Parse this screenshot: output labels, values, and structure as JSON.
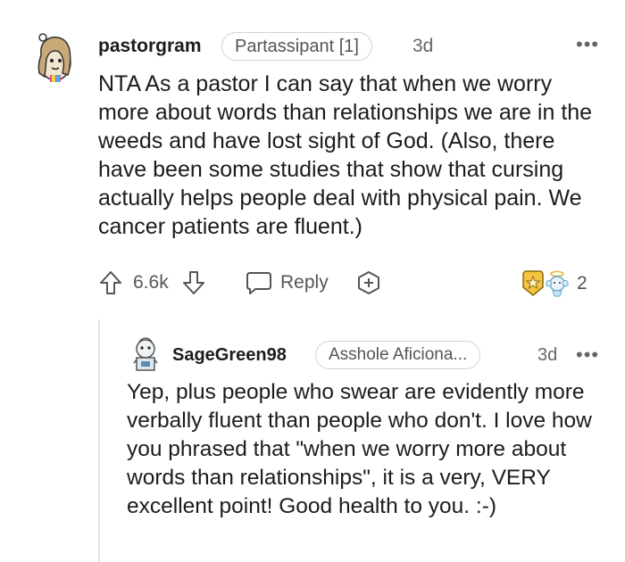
{
  "comment": {
    "username": "pastorgram",
    "flair": "Partassipant [1]",
    "age": "3d",
    "text": "NTA As a pastor I can say that when we worry more about words than relationships we are in the weeds and have lost sight of God. (Also, there have been some studies that show that cursing actually helps people deal with physical pain. We cancer patients are fluent.)",
    "score": "6.6k",
    "reply_label": "Reply",
    "awards_count": "2",
    "more_label": "•••"
  },
  "reply": {
    "username": "SageGreen98",
    "flair": "Asshole Aficiona...",
    "age": "3d",
    "text": "Yep, plus people who swear are evidently more verbally fluent than people who don't. I love how you phrased that \"when we worry more about words than relationships\", it is a very, VERY excellent point! Good health to you. :-)",
    "more_label": "•••"
  },
  "icons": {
    "upvote": "arrow-up-icon",
    "downvote": "arrow-down-icon",
    "reply": "speech-bubble-icon",
    "award": "plus-hexagon-icon",
    "awards": "award-badges-icon"
  }
}
